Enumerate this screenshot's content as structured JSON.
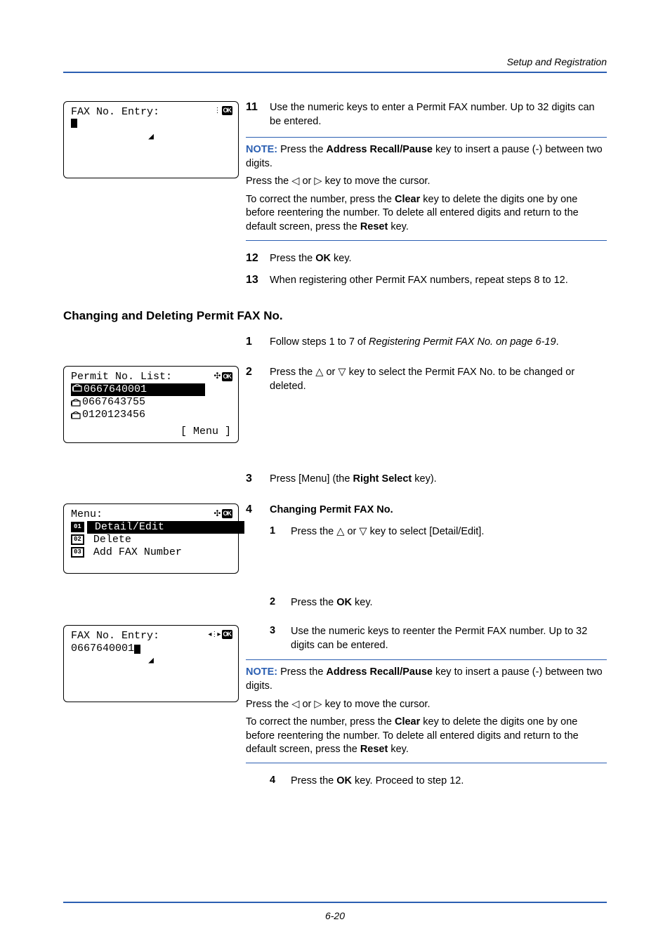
{
  "header": {
    "section_title": "Setup and Registration"
  },
  "lcd1": {
    "title": "FAX No. Entry:",
    "nav_glyph": "∙⁞∙",
    "ok": "OK",
    "arrow": "◢"
  },
  "step11": {
    "num": "11",
    "text": "Use the numeric keys to enter a Permit FAX number. Up to 32 digits can be entered."
  },
  "note1": {
    "label": "NOTE:",
    "l1a": " Press the ",
    "l1b": "Address Recall/Pause",
    "l1c": " key to insert a pause (-) between two digits.",
    "l2a": "Press the ",
    "l2b": " or ",
    "l2c": " key to move the cursor.",
    "l3a": "To correct the number, press the ",
    "l3b": "Clear",
    "l3c": " key to delete the digits one by one before reentering the number. To delete all entered digits and return to the default screen, press the ",
    "l3d": "Reset",
    "l3e": " key."
  },
  "step12": {
    "num": "12",
    "t1": "Press the ",
    "t2": "OK",
    "t3": " key."
  },
  "step13": {
    "num": "13",
    "text": "When registering other Permit FAX numbers, repeat steps 8 to 12."
  },
  "subheading1": "Changing and Deleting Permit FAX No.",
  "step1": {
    "num": "1",
    "t1": "Follow steps 1 to 7 of ",
    "t2": "Registering Permit FAX No. on page 6-19",
    "t3": "."
  },
  "lcd2": {
    "title": "Permit No. List:",
    "ok": "OK",
    "row1": "0667640001",
    "row2": "0667643755",
    "row3": "0120123456",
    "menu": "[  Menu  ]"
  },
  "step2": {
    "num": "2",
    "t1": "Press the ",
    "t2": " or ",
    "t3": " key to select the Permit FAX No. to be changed or deleted."
  },
  "step3": {
    "num": "3",
    "t1": "Press [Menu] (the ",
    "t2": "Right Select",
    "t3": " key)."
  },
  "lcd3": {
    "title": "Menu:",
    "ok": "OK",
    "n1": "01",
    "row1": " Detail/Edit",
    "n2": "02",
    "row2": " Delete",
    "n3": "03",
    "row3": " Add FAX Number"
  },
  "step4": {
    "num": "4",
    "title": "Changing Permit FAX No.",
    "s1n": "1",
    "s1a": "Press the ",
    "s1b": " or ",
    "s1c": " key to select [Detail/Edit].",
    "s2n": "2",
    "s2a": "Press the ",
    "s2b": "OK",
    "s2c": " key.",
    "s3n": "3",
    "s3t": "Use the numeric keys to reenter the Permit FAX number. Up to 32 digits can be entered.",
    "s4n": "4",
    "s4a": "Press the ",
    "s4b": "OK",
    "s4c": " key. Proceed to step 12."
  },
  "lcd4": {
    "title": "FAX No. Entry:",
    "value": "0667640001",
    "nav_glyph": "∙⁞∙",
    "ok": "OK",
    "arrow": "◢"
  },
  "footer": {
    "page": "6-20"
  }
}
